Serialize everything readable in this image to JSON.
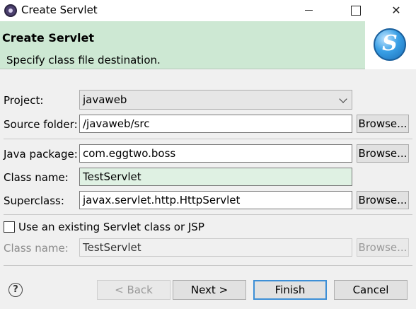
{
  "window": {
    "title": "Create Servlet"
  },
  "banner": {
    "title": "Create Servlet",
    "description": "Specify class file destination."
  },
  "form": {
    "project": {
      "label": "Project:",
      "value": "javaweb"
    },
    "source_folder": {
      "label": "Source folder:",
      "value": "/javaweb/src",
      "browse": "Browse..."
    },
    "java_package": {
      "label": "Java package:",
      "value": "com.eggtwo.boss",
      "browse": "Browse..."
    },
    "class_name": {
      "label": "Class name:",
      "value": "TestServlet"
    },
    "superclass": {
      "label": "Superclass:",
      "value": "javax.servlet.http.HttpServlet",
      "browse": "Browse..."
    },
    "existing_checkbox": {
      "label": "Use an existing Servlet class or JSP",
      "checked": false
    },
    "existing_class_name": {
      "label": "Class name:",
      "value": "TestServlet",
      "browse": "Browse..."
    }
  },
  "footer": {
    "help": "?",
    "back": "< Back",
    "next": "Next >",
    "finish": "Finish",
    "cancel": "Cancel"
  }
}
